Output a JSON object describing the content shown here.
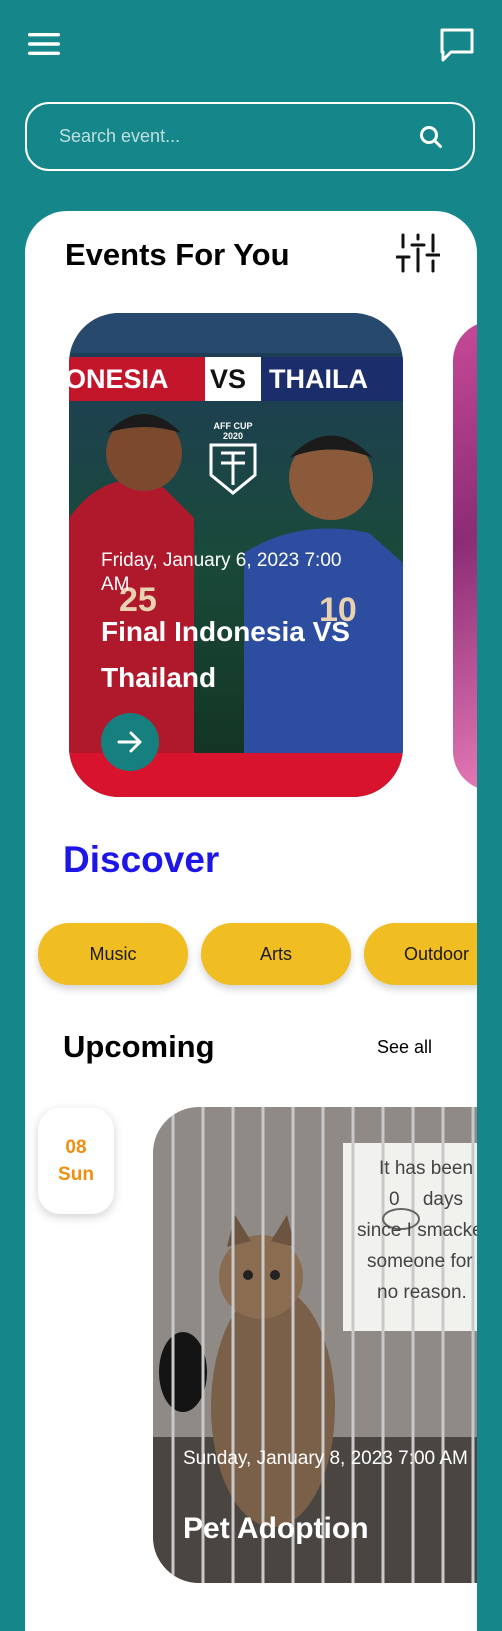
{
  "search": {
    "placeholder": "Search event..."
  },
  "events_for_you": {
    "title": "Events For You",
    "featured": {
      "banner_left": "ONESIA",
      "banner_vs": "VS",
      "banner_right": "THAILA",
      "badge_line1": "AFF CUP",
      "badge_line2": "2020",
      "left_jersey_number": "25",
      "right_jersey_number": "10",
      "date": "Friday, January 6, 2023 7:00 AM",
      "title": "Final Indonesia VS Thailand"
    }
  },
  "discover": {
    "title": "Discover",
    "categories": [
      "Music",
      "Arts",
      "Outdoor"
    ]
  },
  "upcoming": {
    "title": "Upcoming",
    "see_all": "See all",
    "badge": {
      "day": "08",
      "weekday": "Sun"
    },
    "event": {
      "sign_line1": "It has been",
      "sign_count": "0",
      "sign_line2": "days",
      "sign_line3": "since I smacked",
      "sign_line4": "someone for",
      "sign_line5": "no reason.",
      "date": "Sunday, January 8, 2023 7:00 AM",
      "title": "Pet Adoption"
    }
  },
  "colors": {
    "background": "#15868a",
    "accent_blue": "#1e16e6",
    "chip_yellow": "#f0bd22",
    "date_orange": "#f08f0f"
  },
  "icons": [
    "hamburger-menu-icon",
    "chat-icon",
    "search-icon",
    "filter-sliders-icon",
    "arrow-right-icon"
  ]
}
